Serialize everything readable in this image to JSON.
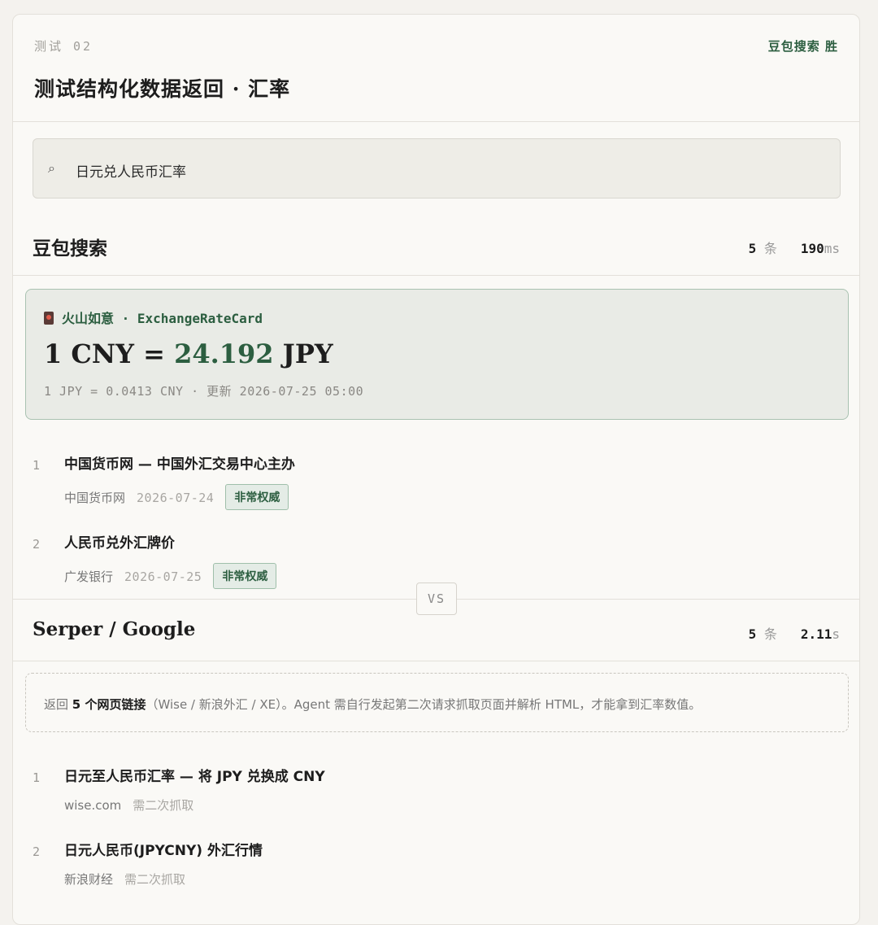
{
  "header": {
    "test_no": "测试 02",
    "winner": "豆包搜索 胜",
    "title": "测试结构化数据返回 · 汇率"
  },
  "search": {
    "icon": "search-icon",
    "query": "日元兑人民币汇率"
  },
  "doubao": {
    "title": "豆包搜索",
    "count": "5",
    "count_unit": "条",
    "time_value": "190",
    "time_unit": "ms",
    "card": {
      "source": "火山如意 · ExchangeRateCard",
      "rate_prefix": "1 CNY = ",
      "rate_value": "24.192",
      "rate_suffix": " JPY",
      "sub": "1 JPY = 0.0413 CNY · 更新 2026-07-25 05:00"
    },
    "results": [
      {
        "num": "1",
        "title": "中国货币网 — 中国外汇交易中心主办",
        "source": "中国货币网",
        "date": "2026-07-24",
        "tag": "非常权威"
      },
      {
        "num": "2",
        "title": "人民币兑外汇牌价",
        "source": "广发银行",
        "date": "2026-07-25",
        "tag": "非常权威"
      }
    ]
  },
  "vs_label": "VS",
  "serper": {
    "title": "Serper / Google",
    "count": "5",
    "count_unit": "条",
    "time_value": "2.11",
    "time_unit": "s",
    "note_prefix": "返回 ",
    "note_bold": "5 个网页链接",
    "note_suffix": "（Wise / 新浪外汇 / XE）。Agent 需自行发起第二次请求抓取页面并解析 HTML，才能拿到汇率数值。",
    "results": [
      {
        "num": "1",
        "title": "日元至人民币汇率 — 将 JPY 兑换成 CNY",
        "source": "wise.com",
        "need": "需二次抓取"
      },
      {
        "num": "2",
        "title": "日元人民币(JPYCNY) 外汇行情",
        "source": "新浪财经",
        "need": "需二次抓取"
      }
    ]
  }
}
